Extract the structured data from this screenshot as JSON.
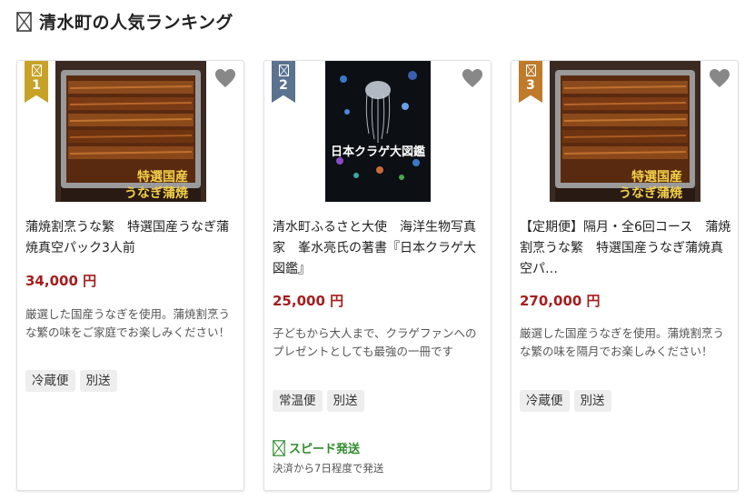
{
  "header": {
    "title": "清水町の人気ランキング"
  },
  "products": [
    {
      "rank": "1",
      "name": "蒲焼割烹うな繁　特選国産うなぎ蒲焼真空パック3人前",
      "price": "34,000 円",
      "description": "厳選した国産うなぎを使用。蒲焼割烹うな繁の味をご家庭でお楽しみください！",
      "tags": [
        "冷蔵便",
        "別送"
      ],
      "image_caption": [
        "特選国産",
        "うなぎ蒲焼"
      ]
    },
    {
      "rank": "2",
      "name": "清水町ふるさと大使　海洋生物写真家　峯水亮氏の著書『日本クラゲ大図鑑』",
      "price": "25,000 円",
      "description": "子どもから大人まで、クラゲファンへのプレゼントとしても最強の一冊です",
      "tags": [
        "常温便",
        "別送"
      ],
      "image_caption": [
        "日本クラゲ大図鑑"
      ],
      "speed_label": "スピード発送",
      "speed_note": "決済から7日程度で発送"
    },
    {
      "rank": "3",
      "name": "【定期便】隔月・全6回コース　蒲焼割烹うな繁　特選国産うなぎ蒲焼真空パ…",
      "price": "270,000 円",
      "description": "厳選した国産うなぎを使用。蒲焼割烹うな繁の味を隔月でお楽しみください！",
      "tags": [
        "冷蔵便",
        "別送"
      ],
      "image_caption": [
        "特選国産",
        "うなぎ蒲焼"
      ]
    }
  ],
  "colors": {
    "price": "#a51e1e",
    "rank1": "#c8a227",
    "rank2": "#5b7290",
    "rank3": "#bf7a2a",
    "speed": "#2e8b2e"
  },
  "icons": [
    "crown-box-icon",
    "heart-icon",
    "speed-icon"
  ]
}
